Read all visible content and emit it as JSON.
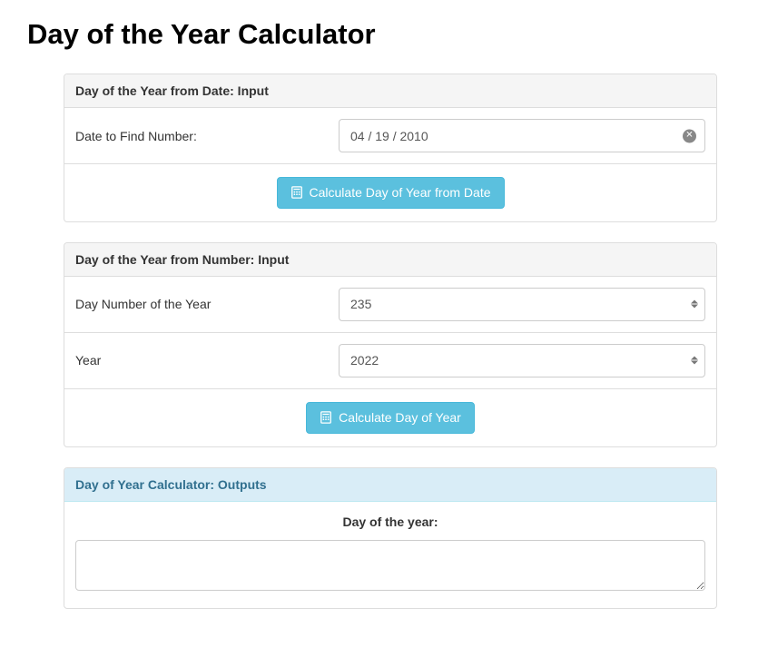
{
  "page": {
    "title": "Day of the Year Calculator"
  },
  "panel_from_date": {
    "heading": "Day of the Year from Date: Input",
    "date_label": "Date to Find Number:",
    "date_value": "04 / 19 / 2010",
    "button_label": "Calculate Day of Year from Date"
  },
  "panel_from_number": {
    "heading": "Day of the Year from Number: Input",
    "daynum_label": "Day Number of the Year",
    "daynum_value": "235",
    "year_label": "Year",
    "year_value": "2022",
    "button_label": "Calculate Day of Year"
  },
  "panel_output": {
    "heading": "Day of Year Calculator: Outputs",
    "result_label": "Day of the year:",
    "result_value": ""
  }
}
